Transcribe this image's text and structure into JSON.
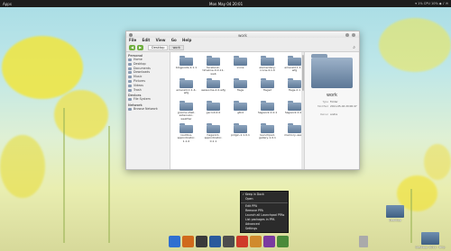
{
  "top_panel": {
    "apps_label": "Apps",
    "clock": "Mon May 04 20:01",
    "tray_text": "▾ 1% CPU 10% ◆ ♪ ✉"
  },
  "window": {
    "title": "work",
    "menu": [
      "File",
      "Edit",
      "View",
      "Go",
      "Help"
    ],
    "crumbs": [
      "Desktop",
      "work"
    ],
    "sidebar": {
      "sections": [
        {
          "header": "Personal",
          "items": [
            "Home",
            "Desktop",
            "Documents",
            "Downloads",
            "Music",
            "Pictures",
            "Videos",
            "Trash"
          ]
        },
        {
          "header": "Devices",
          "items": [
            "File System"
          ]
        },
        {
          "header": "Network",
          "items": [
            "Browse Network"
          ]
        }
      ]
    },
    "files": [
      "blogposts-1.1.1",
      "facebook-timeline-0.0.11-web",
      "icons",
      "elementary-icons-4.1.0",
      "",
      "emerald-1.1.4-wfg",
      "emerald-1.1.4-wfg",
      "awesome-2.0-wfg",
      "flags",
      "",
      "flags2",
      "flags-2.1",
      "gnome-shell-extension-weather",
      "gscroll-2.0",
      "",
      "gtk4",
      "hagwork-1.0.1",
      "hagwork-1.0.2",
      "nautilus-appindicator-1.1.0",
      "",
      "hagwork-appindicator-0.1.1",
      "pidgin-1.1.0.1",
      "launchpad-gallery-1.0.1",
      "memory-usage",
      ""
    ],
    "details": {
      "name": "work",
      "rows": [
        {
          "k": "Type",
          "v": "Folder"
        },
        {
          "k": "Modified",
          "v": "2011-05-04 20:00:47"
        },
        {
          "k": "Owner",
          "v": "andre"
        }
      ]
    }
  },
  "context_menu": {
    "items": [
      {
        "label": "Keep in Dock",
        "checked": true
      },
      {
        "label": "Open",
        "checked": false
      },
      {
        "sep": true
      },
      {
        "label": "Edit PPA",
        "checked": false
      },
      {
        "label": "Remove PPA",
        "checked": false
      },
      {
        "label": "Launch all Launchpad PPAs",
        "checked": false
      },
      {
        "label": "List packages in PPA",
        "checked": false
      },
      {
        "label": "Advanced",
        "checked": false
      },
      {
        "label": "Settings",
        "checked": false
      }
    ]
  },
  "desktop_icons": [
    {
      "label": "Desktop",
      "id": "desk-a"
    },
    {
      "label": "Desktop 2011 - tmp",
      "id": "desk-b"
    }
  ],
  "dock_colors": [
    "#2f6fd0",
    "#d06a1c",
    "#3a3a3a",
    "#2a5a9c",
    "#4d4d4d",
    "#cf3b2a",
    "#d08a2c",
    "#7a3aa0",
    "#4a8a3a"
  ]
}
